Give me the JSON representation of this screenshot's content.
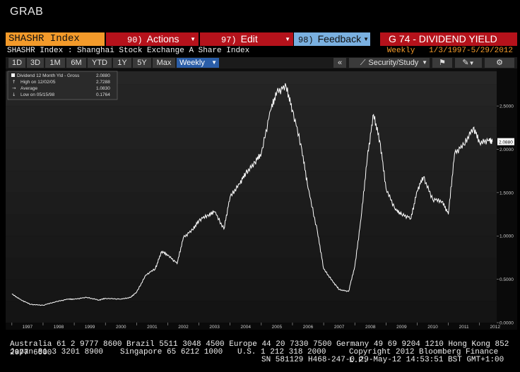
{
  "window": {
    "title": "GRAB"
  },
  "header": {
    "ticker": "SHASHR Index",
    "buttons": [
      {
        "code": "90)",
        "label": "Actions"
      },
      {
        "code": "97)",
        "label": "Edit"
      },
      {
        "code": "98)",
        "label": "Feedback"
      }
    ],
    "function_title": "G 74 - DIVIDEND YIELD",
    "security_desc": "SHASHR Index : Shanghai Stock Exchange A Share Index",
    "frequency": "Weekly",
    "date_range": "1/3/1997-5/29/2012"
  },
  "toolbar": {
    "periods": [
      "1D",
      "3D",
      "1M",
      "6M",
      "YTD",
      "1Y",
      "5Y",
      "Max"
    ],
    "frequency_select": "Weekly",
    "collapse_label": "«",
    "security_study_label": "Security/Study"
  },
  "legend": {
    "series": "Dividend 12 Month Yld - Gross",
    "last": "2.0880",
    "high_label": "High on 12/02/05",
    "high_value": "2.7288",
    "avg_label": "Average",
    "avg_value": "1.0830",
    "low_label": "Low on 05/15/98",
    "low_value": "0.1764"
  },
  "chart_data": {
    "type": "line",
    "series": [
      {
        "name": "Dividend 12 Month Yld - Gross",
        "x": [
          1997.0,
          1997.3,
          1997.6,
          1998.0,
          1998.4,
          1998.8,
          1999.0,
          1999.4,
          1999.8,
          2000.0,
          2000.5,
          2000.8,
          2001.0,
          2001.3,
          2001.6,
          2001.8,
          2002.0,
          2002.3,
          2002.5,
          2002.8,
          2003.0,
          2003.3,
          2003.5,
          2003.8,
          2004.0,
          2004.3,
          2004.5,
          2004.8,
          2005.0,
          2005.3,
          2005.5,
          2005.8,
          2006.0,
          2006.3,
          2006.5,
          2006.8,
          2007.0,
          2007.3,
          2007.5,
          2007.8,
          2008.0,
          2008.2,
          2008.4,
          2008.6,
          2008.8,
          2009.0,
          2009.3,
          2009.5,
          2009.8,
          2010.0,
          2010.2,
          2010.5,
          2010.8,
          2011.0,
          2011.2,
          2011.5,
          2011.8,
          2012.0,
          2012.3,
          2012.41
        ],
        "values": [
          0.33,
          0.26,
          0.21,
          0.2,
          0.24,
          0.27,
          0.27,
          0.29,
          0.26,
          0.28,
          0.27,
          0.29,
          0.35,
          0.55,
          0.62,
          0.82,
          0.78,
          0.68,
          0.98,
          1.07,
          1.18,
          1.24,
          1.28,
          1.08,
          1.45,
          1.6,
          1.72,
          1.85,
          1.95,
          2.45,
          2.66,
          2.72,
          2.45,
          2.0,
          1.55,
          1.05,
          0.62,
          0.47,
          0.38,
          0.36,
          0.65,
          1.2,
          1.9,
          2.4,
          2.1,
          1.55,
          1.3,
          1.25,
          1.2,
          1.52,
          1.68,
          1.42,
          1.4,
          1.25,
          1.95,
          2.05,
          2.25,
          2.08,
          2.1,
          2.088
        ]
      }
    ],
    "x_tick_labels": [
      "1997",
      "1998",
      "1999",
      "2000",
      "2001",
      "2002",
      "2003",
      "2004",
      "2005",
      "2006",
      "2007",
      "2008",
      "2009",
      "2010",
      "2011",
      "2012"
    ],
    "y_tick_labels": [
      "0.0000",
      "0.5000",
      "1.0000",
      "1.5000",
      "2.0000",
      "2.5000"
    ],
    "xlim": [
      1996.8,
      2012.55
    ],
    "ylim": [
      0,
      2.9
    ],
    "last_value_label": "2.0880",
    "grid": "horizontal bands",
    "legend_position": "top-left",
    "colors": {
      "line": "#ffffff",
      "background": "#1e1e1e",
      "band": "#262626"
    }
  },
  "footer": {
    "line1": "Australia 61 2 9777 8600 Brazil 5511 3048 4500 Europe 44 20 7330 7500 Germany 49 69 9204 1210 Hong Kong 852 2977 6000",
    "line2_left": "Japan 81 3 3201 8900",
    "line2_mid1": "Singapore 65 6212 1000",
    "line2_mid2": "U.S. 1 212 318 2000",
    "line2_right": "Copyright 2012 Bloomberg Finance L.P.",
    "line3": "SN 581129 H468-247-0 29-May-12 14:53:51 BST  GMT+1:00"
  },
  "colors": {
    "accent": "#f39a2a",
    "function_red": "#b5121b",
    "active_tab": "#2b5ea8",
    "feedback": "#7ab0e0"
  }
}
